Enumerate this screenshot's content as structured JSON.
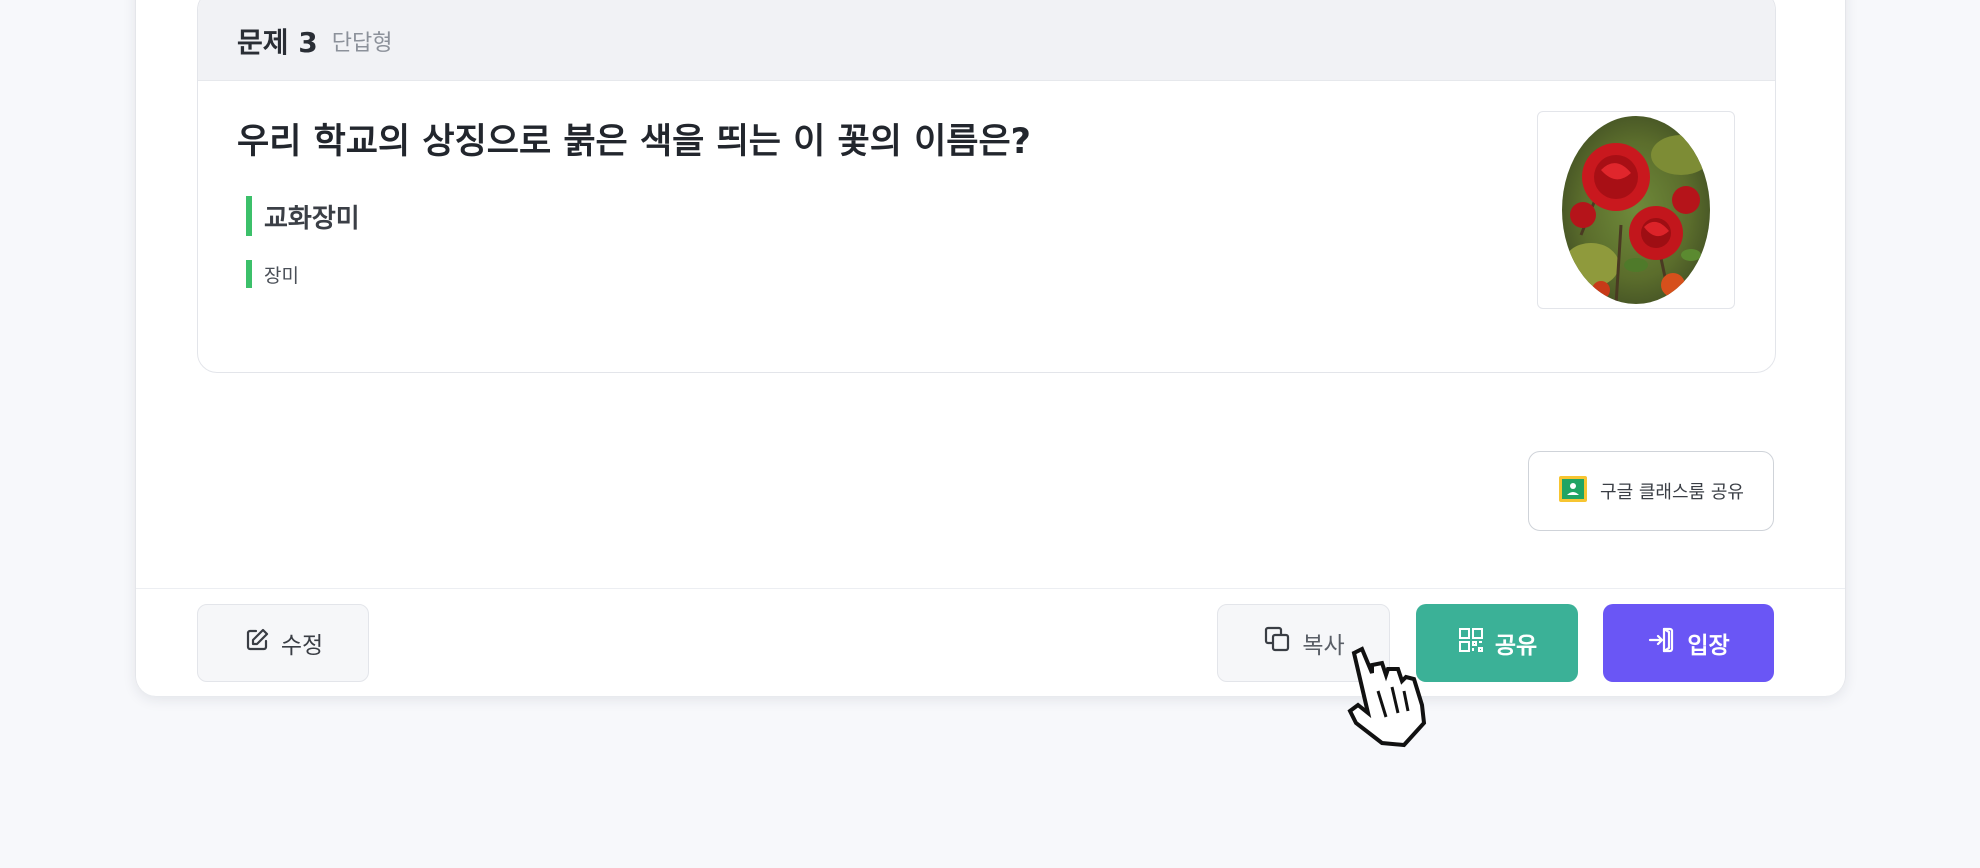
{
  "question": {
    "number_label": "문제 3",
    "type_label": "단답형",
    "title": "우리 학교의 상징으로 붉은 색을 띄는 이 꽃의 이름은?",
    "answers": [
      "교화장미",
      "장미"
    ]
  },
  "share": {
    "classroom_label": "구글 클래스룸 공유"
  },
  "footer": {
    "edit_label": "수정",
    "copy_label": "복사",
    "share_label": "공유",
    "enter_label": "입장"
  },
  "colors": {
    "accent_green": "#3bb197",
    "accent_purple": "#6a56f5",
    "answer_bar": "#3cc06a"
  }
}
